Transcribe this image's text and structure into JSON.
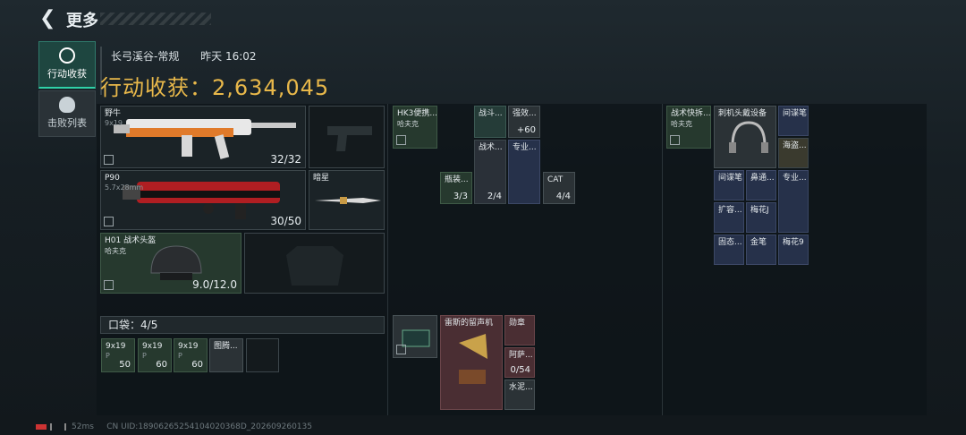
{
  "header": {
    "back_icon": "back-arrow-icon",
    "title": "更多"
  },
  "sidebar": {
    "items": [
      {
        "label": "行动收获",
        "icon": "target-icon",
        "active": true
      },
      {
        "label": "击败列表",
        "icon": "skull-icon",
        "active": false
      }
    ]
  },
  "match": {
    "map": "长弓溪谷-常规",
    "time": "昨天 16:02"
  },
  "haul": {
    "label": "行动收获：",
    "value": "2,634,045"
  },
  "equipment": {
    "primary": {
      "name": "野牛",
      "ammo": "9x19",
      "count": "32/32"
    },
    "secondary": {
      "name": "P90",
      "ammo": "5.7x28mm",
      "count": "30/50"
    },
    "melee": {
      "name": "暗星"
    },
    "helmet": {
      "name": "H01 战术头盔",
      "brand": "哈夫克",
      "durability": "9.0/12.0"
    }
  },
  "pocket": {
    "label": "口袋：",
    "count": "4/5",
    "items": [
      {
        "name": "9x19",
        "sub": "P",
        "qty": "50"
      },
      {
        "name": "9x19",
        "sub": "P",
        "qty": "60"
      },
      {
        "name": "9x19",
        "sub": "P",
        "qty": "60"
      },
      {
        "name": "图腾...",
        "sub": "",
        "qty": ""
      }
    ]
  },
  "rig": {
    "items": [
      {
        "name": "HK3便携...",
        "sub": "哈夫克"
      },
      {
        "name": "战斗..."
      },
      {
        "name": "强效...",
        "qty": "+60"
      },
      {
        "name": "战术..."
      },
      {
        "name": "专业..."
      },
      {
        "name": "瓶装...",
        "qty": "3/3"
      },
      {
        "name": "",
        "qty": "2/4"
      },
      {
        "name": "CAT",
        "qty": "4/4"
      }
    ]
  },
  "backpack": {
    "items": [
      {
        "name": "雷斯的留声机"
      },
      {
        "name": "勋章"
      },
      {
        "name": "阿萨...",
        "qty": "0/54"
      },
      {
        "name": "水泥..."
      }
    ]
  },
  "case": {
    "header": {
      "name": "战术快拆...",
      "sub": "哈夫克"
    },
    "items": [
      {
        "name": "刺机头戴设备"
      },
      {
        "name": "间谍笔"
      },
      {
        "name": "海盗..."
      },
      {
        "name": "间谍笔"
      },
      {
        "name": "鼻通..."
      },
      {
        "name": "专业..."
      },
      {
        "name": "扩容..."
      },
      {
        "name": "梅花J"
      },
      {
        "name": "固态..."
      },
      {
        "name": "金笔"
      },
      {
        "name": "梅花9"
      }
    ]
  },
  "footer": {
    "ping": "52ms",
    "uid": "CN UID:18906265254104020368D_202609260135"
  }
}
